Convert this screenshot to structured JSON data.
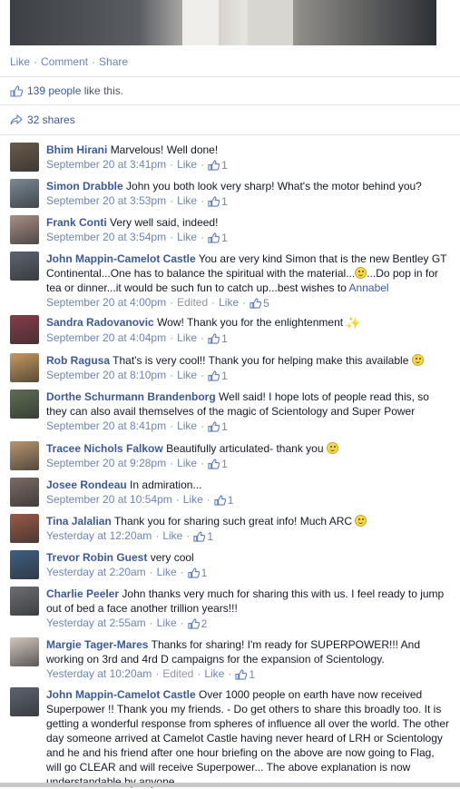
{
  "post": {
    "actions": {
      "like": "Like",
      "comment": "Comment",
      "share": "Share"
    },
    "likes": {
      "count_text": "139 people",
      "suffix": " like this."
    },
    "shares": {
      "text": "32 shares"
    }
  },
  "comments": [
    {
      "author": "Bhim Hirani",
      "text": "Marvelous! Well done!",
      "time": "September 20 at 3:41pm",
      "like": "Like",
      "count": "1",
      "avatar_color": "#6b5a4a"
    },
    {
      "author": "Simon Drabble",
      "text": "John you both look very sharp! What's the motor behind you?",
      "time": "September 20 at 3:53pm",
      "like": "Like",
      "count": "1",
      "avatar_color": "#7a8a96"
    },
    {
      "author": "Frank Conti",
      "text": "Very well said, indeed!",
      "time": "September 20 at 3:54pm",
      "like": "Like",
      "count": "1",
      "avatar_color": "#a88f86"
    },
    {
      "author": "John Mappin-Camelot Castle",
      "text_a": "You are very kind Simon that is the new Bentley GT Continental...One has to balance the spiritual with the material...",
      "text_b": "...Do pop in for tea or dinner...it would be such fun to catch up...best wishes to",
      "link": "Annabel",
      "time": "September 20 at 4:00pm",
      "edited": "Edited",
      "like": "Like",
      "count": "5",
      "avatar_color": "#5d6470"
    },
    {
      "author": "Sandra Radovanovic",
      "text": "Wow! Thank you for the enlightenment",
      "time": "September 20 at 4:04pm",
      "like": "Like",
      "count": "1",
      "avatar_color": "#8a3b4a"
    },
    {
      "author": "Rob Ragusa",
      "text": "That's is very cool!! Thank you for helping make this available",
      "time": "September 20 at 8:10pm",
      "like": "Like",
      "count": "1",
      "avatar_color": "#c79a5e"
    },
    {
      "author": "Dorthe Schurmann Brandenborg",
      "text": "Well said! I hope lots of people read this, so they can also avail themselves of the magic of Scientology and Super Power",
      "time": "September 20 at 8:41pm",
      "like": "Like",
      "count": "1",
      "avatar_color": "#5e6e52"
    },
    {
      "author": "Tracee Nichols Falkow",
      "text": "Beautifully articulated- thank you",
      "time": "September 20 at 9:28pm",
      "like": "Like",
      "count": "1",
      "avatar_color": "#b99570"
    },
    {
      "author": "Josee Rondeau",
      "text": "In admiration...",
      "time": "September 20 at 10:54pm",
      "like": "Like",
      "count": "1",
      "avatar_color": "#7d6a66"
    },
    {
      "author": "Tina Jalalian",
      "text": "Thank you for sharing such great info! Much ARC",
      "time": "Yesterday at 12:20am",
      "like": "Like",
      "count": "1",
      "avatar_color": "#9a5a45"
    },
    {
      "author": "Trevor Robin Guest",
      "text": "very cool",
      "time": "Yesterday at 2:20am",
      "like": "Like",
      "count": "1",
      "avatar_color": "#3e5f86"
    },
    {
      "author": "Charlie Peeler",
      "text": "John thanks very much for sharing this with us. I feel ready to jump out of bed a face another trillion years!!!",
      "time": "Yesterday at 2:55am",
      "like": "Like",
      "count": "2",
      "avatar_color": "#6c6f73"
    },
    {
      "author": "Margie Tager-Mares",
      "text": "Thanks for sharing! I'm ready for SUPERPOWER!!! And working on 3rd and 4rd D campaigns for the expansion of Scientology.",
      "time": "Yesterday at 10:20am",
      "edited": "Edited",
      "like": "Like",
      "count": "1",
      "avatar_color": "#d3c7be"
    },
    {
      "author": "John Mappin-Camelot Castle",
      "text": "Over 1000 people on earth have now received Superpower !! Thank you my friends. - Do get others to share this broadly too. It is getting a wonderful response from spheres of influence all over the world. The other day someone arrived at Camelot Castle having never heard of LRH or Scientology and he and his friend after one hour briefing on the above are now going to Flag, will go CLEAR and will receive Superpower... The above explanation is now understandable by anyone.",
      "avatar_color": "#5d6470"
    }
  ],
  "icons": {
    "thumb": "thumbs-up-icon",
    "share": "share-arrow-icon",
    "smile": "smiley-emoji-icon",
    "sparkle": "sparkles-emoji-icon"
  },
  "colors": {
    "link": "#3b5998",
    "meta": "#90949c",
    "text": "#141823"
  }
}
